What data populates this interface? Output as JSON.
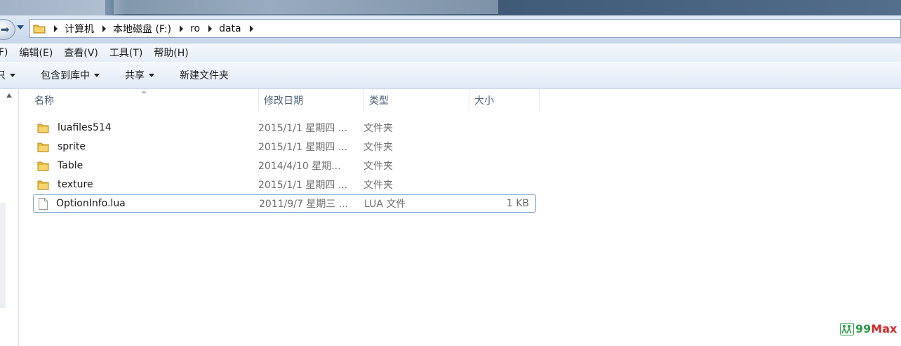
{
  "address": {
    "crumbs": [
      "计算机",
      "本地磁盘 (F:)",
      "ro",
      "data"
    ]
  },
  "menu": [
    "F)",
    "编辑(E)",
    "查看(V)",
    "工具(T)",
    "帮助(H)"
  ],
  "toolbar": {
    "partial": "只",
    "include_library": "包含到库中",
    "share": "共享",
    "new_folder": "新建文件夹"
  },
  "columns": {
    "name": "名称",
    "modified": "修改日期",
    "type": "类型",
    "size": "大小"
  },
  "files": [
    {
      "name": "luafiles514",
      "modified": "2015/1/1 星期四 ...",
      "type": "文件夹",
      "size": "",
      "icon": "folder-icon"
    },
    {
      "name": "sprite",
      "modified": "2015/1/1 星期四 ...",
      "type": "文件夹",
      "size": "",
      "icon": "folder-icon"
    },
    {
      "name": "Table",
      "modified": "2014/4/10 星期...",
      "type": "文件夹",
      "size": "",
      "icon": "folder-icon"
    },
    {
      "name": "texture",
      "modified": "2015/1/1 星期四 ...",
      "type": "文件夹",
      "size": "",
      "icon": "folder-icon"
    },
    {
      "name": "OptionInfo.lua",
      "modified": "2011/9/7 星期三 ...",
      "type": "LUA 文件",
      "size": "1 KB",
      "icon": "file-icon"
    }
  ],
  "watermark": {
    "part1": "99",
    "part2": "Max"
  },
  "colors": {
    "folder": "#e8bb3c",
    "selection_border": "#7da2ce",
    "header_text": "#4c607a"
  }
}
